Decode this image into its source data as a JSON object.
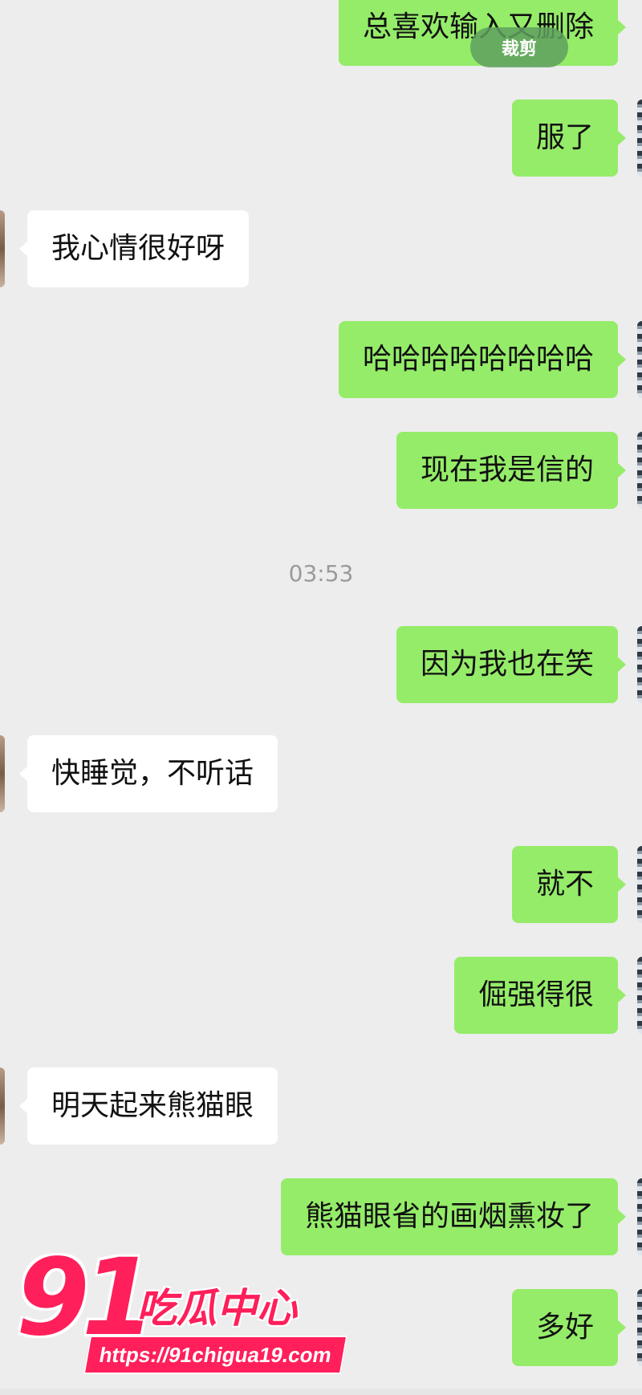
{
  "messages": [
    {
      "dir": "out",
      "text": "总喜欢输入又删除"
    },
    {
      "dir": "out",
      "text": "服了"
    },
    {
      "dir": "in",
      "text": "我心情很好呀"
    },
    {
      "dir": "out",
      "text": "哈哈哈哈哈哈哈哈"
    },
    {
      "dir": "out",
      "text": "现在我是信的"
    },
    {
      "dir": "out",
      "text": "因为我也在笑"
    },
    {
      "dir": "in",
      "text": "快睡觉，不听话"
    },
    {
      "dir": "out",
      "text": "就不"
    },
    {
      "dir": "out",
      "text": "倔强得很"
    },
    {
      "dir": "in",
      "text": "明天起来熊猫眼"
    },
    {
      "dir": "out",
      "text": "熊猫眼省的画烟熏妆了"
    },
    {
      "dir": "out",
      "text": "多好"
    }
  ],
  "timestamp": "03:53",
  "crop_button": "裁剪",
  "watermark": {
    "number": "91",
    "name": "吃瓜中心",
    "url": "https://91chigua19.com"
  },
  "colors": {
    "background": "#ededed",
    "outgoing_bubble": "#95ec69",
    "incoming_bubble": "#ffffff",
    "watermark": "#ff1f5a"
  }
}
